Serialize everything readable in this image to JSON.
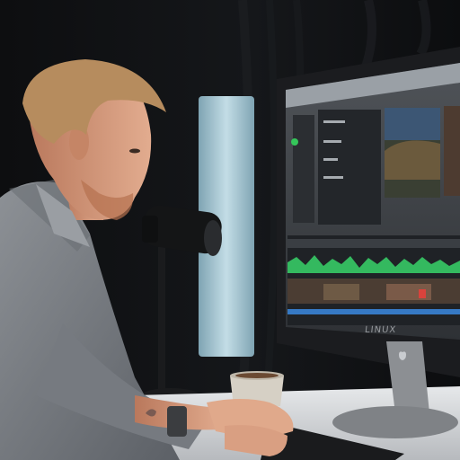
{
  "scene": {
    "description_free": true,
    "monitor_brand_text": "LINUX",
    "colors": {
      "background": "#0b0c0e",
      "curtain": "#141518",
      "light_panel": "#a9c6d2",
      "shirt": "#7d8187",
      "skin": "#d9a184",
      "hair": "#b68c5e",
      "monitor_bezel": "#1b1c1f",
      "screen_ui": "#3a3d42",
      "waveform_green": "#38d46a",
      "desk": "#d8dadc"
    },
    "icons": [
      "microphone-icon",
      "apple-logo-icon"
    ]
  }
}
